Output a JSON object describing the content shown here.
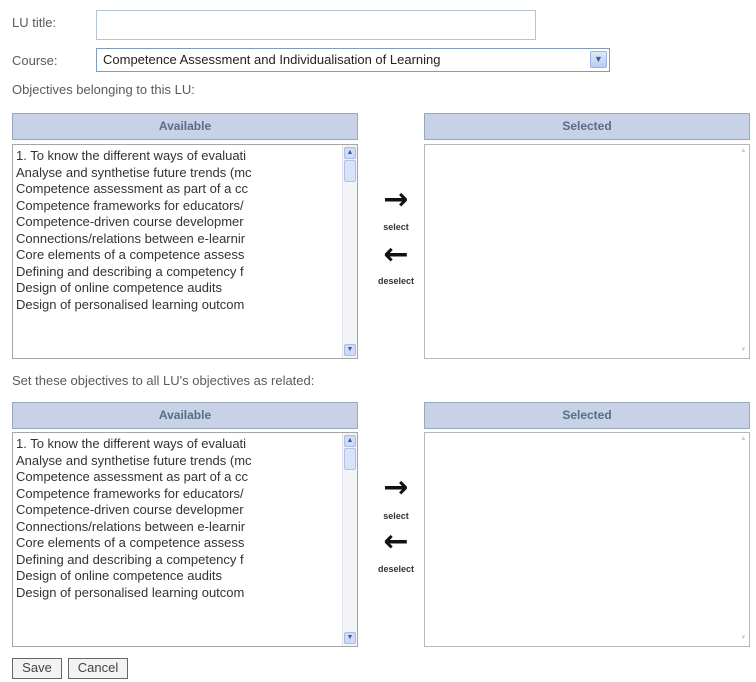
{
  "form": {
    "lu_title_label": "LU title:",
    "lu_title_value": "",
    "course_label": "Course:",
    "course_value": "Competence Assessment and Individualisation of Learning",
    "objectives_label": "Objectives belonging to this LU:",
    "related_label": "Set these objectives to all LU's objectives as related:"
  },
  "panels": {
    "available_header": "Available",
    "selected_header": "Selected",
    "select_label": "select",
    "deselect_label": "deselect"
  },
  "available_items": [
    "1. To know the different ways of evaluati",
    "Analyse and synthetise future trends (mc",
    "Competence assessment as part of a cc",
    "Competence frameworks for educators/",
    "Competence-driven course developmer",
    "Connections/relations between e-learnir",
    "Core elements of a competence assess",
    "Defining and describing a competency f",
    "Design of online competence audits",
    "Design of personalised learning outcom"
  ],
  "buttons": {
    "save": "Save",
    "cancel": "Cancel"
  }
}
